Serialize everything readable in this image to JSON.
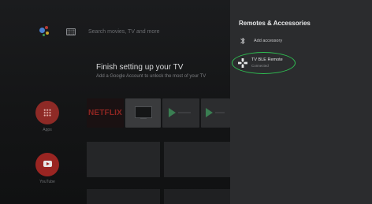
{
  "home": {
    "search_placeholder": "Search movies, TV and more",
    "setup_title": "Finish setting up your TV",
    "setup_subtitle": "Add a Google Account to unlock the most of your TV",
    "apps_label": "Apps",
    "youtube_label": "YouTube",
    "netflix_wordmark": "NETFLIX"
  },
  "panel": {
    "title": "Remotes & Accessories",
    "add_accessory": "Add accessory",
    "devices": [
      {
        "name": "TV BLE Remote",
        "status": "Connected"
      }
    ]
  },
  "colors": {
    "highlight": "#2fbf52",
    "panel_bg": "#2b2c2e",
    "netflix_red": "#8f2622"
  },
  "icons": [
    "assistant-icon",
    "keyboard-icon",
    "apps-icon",
    "youtube-icon",
    "bluetooth-icon",
    "gamepad-icon"
  ]
}
